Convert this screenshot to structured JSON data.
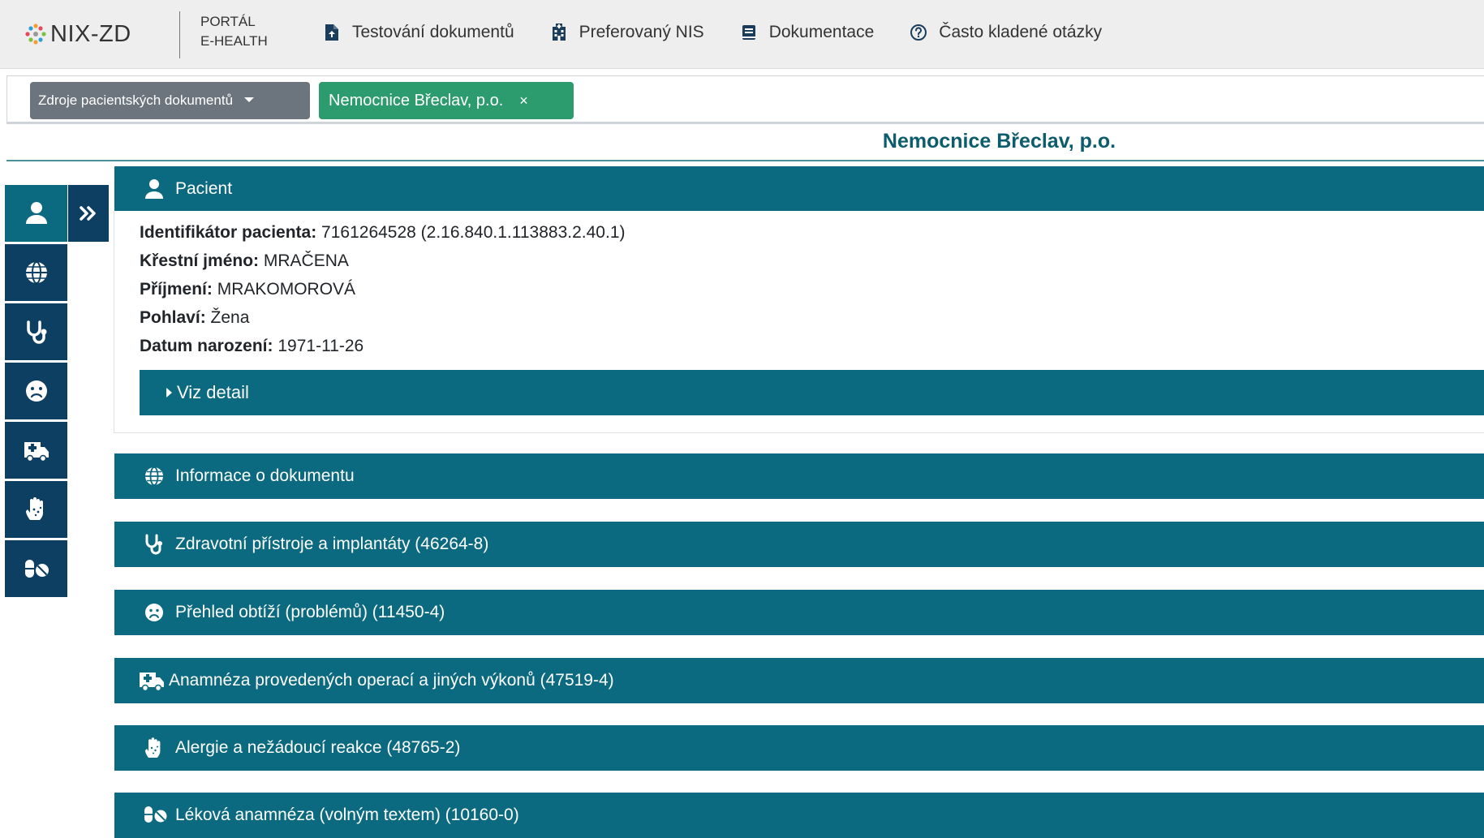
{
  "navbar": {
    "logo_text": "NIX-ZD",
    "portal_line1": "PORTÁL",
    "portal_line2": "E-HEALTH",
    "items": [
      {
        "label": "Testování dokumentů",
        "icon": "file-upload-icon"
      },
      {
        "label": "Preferovaný NIS",
        "icon": "hospital-icon"
      },
      {
        "label": "Dokumentace",
        "icon": "book-icon"
      },
      {
        "label": "Často kladené otázky",
        "icon": "question-circle-icon"
      }
    ]
  },
  "filters": {
    "dropdown_label": "Zdroje pacientských dokumentů",
    "chip_label": "Nemocnice Břeclav, p.o.",
    "chip_close": "×"
  },
  "hospital_title": "Nemocnice Břeclav, p.o.",
  "sidebar": {
    "items": [
      {
        "icon": "user-icon",
        "active": true
      },
      {
        "icon": "globe-icon",
        "active": false
      },
      {
        "icon": "stethoscope-icon",
        "active": false
      },
      {
        "icon": "frown-icon",
        "active": false
      },
      {
        "icon": "ambulance-icon",
        "active": false
      },
      {
        "icon": "allergy-hand-icon",
        "active": false
      },
      {
        "icon": "pills-icon",
        "active": false
      }
    ],
    "expand_icon": "double-chevron-right-icon"
  },
  "patient": {
    "header": "Pacient",
    "fields": [
      {
        "label": "Identifikátor pacienta:",
        "value": "7161264528 (2.16.840.1.113883.2.40.1)"
      },
      {
        "label": "Křestní jméno:",
        "value": "MRAČENA"
      },
      {
        "label": "Příjmení:",
        "value": "MRAKOMOROVÁ"
      },
      {
        "label": "Pohlaví:",
        "value": "Žena"
      },
      {
        "label": "Datum narození:",
        "value": "1971-11-26"
      }
    ],
    "detail_label": "Viz detail"
  },
  "sections": [
    {
      "label": "Informace o dokumentu",
      "icon": "globe-icon"
    },
    {
      "label": "Zdravotní přístroje a implantáty (46264-8)",
      "icon": "stethoscope-icon"
    },
    {
      "label": "Přehled obtíží (problémů) (11450-4)",
      "icon": "frown-icon"
    },
    {
      "label": "Anamnéza provedených operací a jiných výkonů (47519-4)",
      "icon": "ambulance-icon"
    },
    {
      "label": "Alergie a nežádoucí reakce (48765-2)",
      "icon": "allergy-hand-icon"
    },
    {
      "label": "Léková anamnéza (volným textem) (10160-0)",
      "icon": "pills-icon"
    }
  ],
  "colors": {
    "section_bg": "#0b6a7f",
    "sidebar_bg": "#0d3f63",
    "chip_bg": "#2c9b6e",
    "dropdown_bg": "#6c757d",
    "title_color": "#0d5c6e"
  }
}
